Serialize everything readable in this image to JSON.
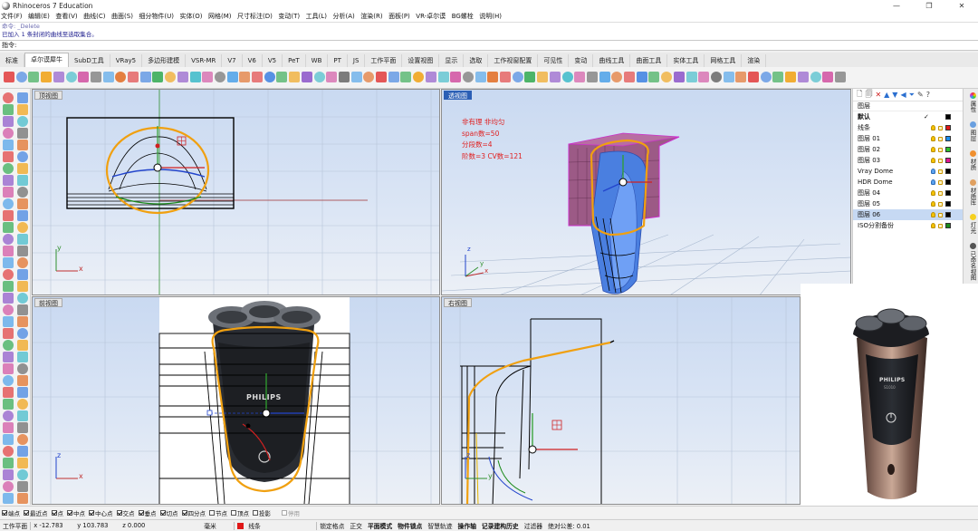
{
  "window": {
    "title": "Rhinoceros 7 Education",
    "controls": [
      "—",
      "❐",
      "✕"
    ]
  },
  "menu": [
    "文件(F)",
    "编辑(E)",
    "查看(V)",
    "曲线(C)",
    "曲面(S)",
    "细分物件(U)",
    "实体(O)",
    "网格(M)",
    "尺寸标注(D)",
    "变动(T)",
    "工具(L)",
    "分析(A)",
    "渲染(R)",
    "面板(P)",
    "VR-卓尔谟",
    "BG螺栓",
    "说明(H)"
  ],
  "command": {
    "history_line1": "命令: _Delete",
    "history_line2": "已加入 1 条封闭的曲线至选取集合。",
    "prompt_label": "指令:",
    "input_value": ""
  },
  "tabs": [
    "标准",
    "卓尔谟犀牛",
    "SubD工具",
    "VRay5",
    "多边形建模",
    "VSR-MR",
    "V7",
    "V6",
    "V5",
    "PeT",
    "WB",
    "PT",
    "JS",
    "工作平面",
    "设置视图",
    "显示",
    "选取",
    "工作视窗配置",
    "可见性",
    "变动",
    "曲线工具",
    "曲面工具",
    "实体工具",
    "网格工具",
    "渲染"
  ],
  "active_tab_index": 1,
  "viewports": {
    "top": {
      "label": "顶视图",
      "axis_x": "x",
      "axis_y": "y"
    },
    "perspective": {
      "label": "透视图",
      "axis_x": "x",
      "axis_y": "y",
      "axis_z": "z"
    },
    "front": {
      "label": "前视图",
      "axis_x": "x",
      "axis_z": "z",
      "brand": "PHILIPS"
    },
    "right": {
      "label": "右视图",
      "axis_y": "y",
      "axis_z": "z"
    }
  },
  "annotations": [
    "非有理  非均匀",
    "span数=50",
    "分段数=4",
    "阶数=3   CV数=121"
  ],
  "annotation_color": "#e02020",
  "layers_panel": {
    "header": "图层",
    "layers": [
      {
        "name": "默认",
        "current": true,
        "bulb": "none",
        "color": "#000000"
      },
      {
        "name": "线条",
        "bulb": "yellow",
        "color": "#e01818"
      },
      {
        "name": "图层 01",
        "bulb": "yellow",
        "color": "#1a8ef0"
      },
      {
        "name": "图层 02",
        "bulb": "yellow",
        "color": "#2cc02c"
      },
      {
        "name": "图层 03",
        "bulb": "yellow",
        "color": "#e01890"
      },
      {
        "name": "Vray Dome",
        "bulb": "blue",
        "color": "#000000"
      },
      {
        "name": "HDR Dome",
        "bulb": "blue",
        "color": "#000000"
      },
      {
        "name": "图层 04",
        "bulb": "yellow",
        "color": "#000000"
      },
      {
        "name": "图层 05",
        "bulb": "yellow",
        "color": "#000000"
      },
      {
        "name": "图层 06",
        "bulb": "yellow",
        "color": "#000000",
        "selected": true
      },
      {
        "name": "ISO分割备份",
        "bulb": "yellow",
        "color": "#1a8a1a"
      }
    ]
  },
  "side_tabs": [
    "属性",
    "图层",
    "材质",
    "材质库",
    "灯光",
    "已命名视图"
  ],
  "photo": {
    "brand": "PHILIPS",
    "model": "S1010"
  },
  "osnaps": [
    {
      "label": "端点",
      "on": true
    },
    {
      "label": "最近点",
      "on": true
    },
    {
      "label": "点",
      "on": true
    },
    {
      "label": "中点",
      "on": true
    },
    {
      "label": "中心点",
      "on": true
    },
    {
      "label": "交点",
      "on": true
    },
    {
      "label": "垂点",
      "on": true
    },
    {
      "label": "切点",
      "on": true
    },
    {
      "label": "四分点",
      "on": true
    },
    {
      "label": "节点",
      "on": false
    },
    {
      "label": "顶点",
      "on": false
    },
    {
      "label": "投影",
      "on": false
    },
    {
      "label": "停用",
      "on": false,
      "disabled": true
    }
  ],
  "status": {
    "cplane": "工作平面",
    "x": "x -12.783",
    "y": "y 103.783",
    "z": "z 0.000",
    "units": "毫米",
    "layer": "线条",
    "modes": [
      "锁定格点",
      "正交",
      "平面模式",
      "物件锁点",
      "智慧轨迹",
      "操作轴",
      "记录建构历史",
      "过滤器"
    ],
    "bold_modes": [
      "平面模式",
      "物件锁点",
      "操作轴",
      "记录建构历史"
    ],
    "tolerance": "绝对公差: 0.01"
  }
}
